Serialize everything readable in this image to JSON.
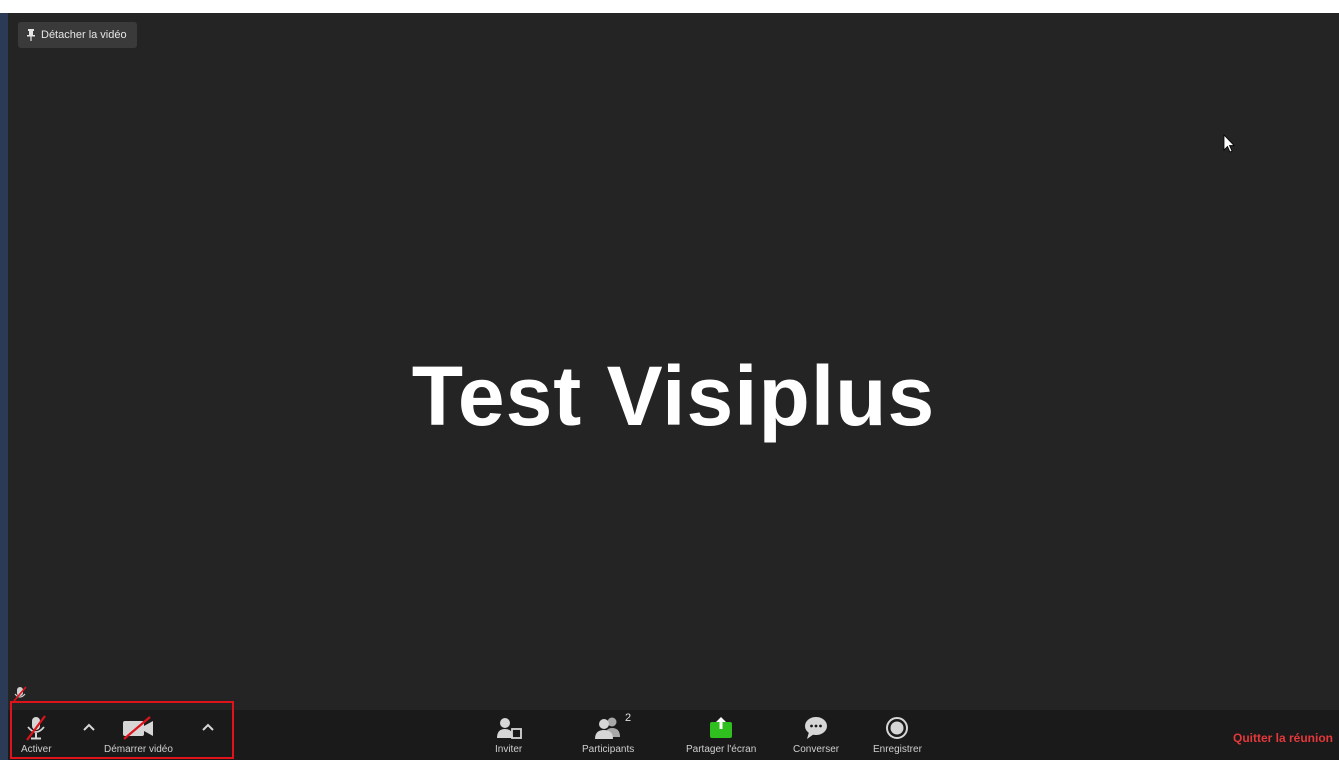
{
  "video": {
    "detach_label": "Détacher la vidéo",
    "participant_name": "Test Visiplus"
  },
  "toolbar": {
    "unmute_label": "Activer",
    "start_video_label": "Démarrer vidéo",
    "invite_label": "Inviter",
    "participants_label": "Participants",
    "participants_count": "2",
    "share_screen_label": "Partager l'écran",
    "chat_label": "Converser",
    "record_label": "Enregistrer",
    "leave_label": "Quitter la réunion"
  },
  "colors": {
    "share_green": "#2fbf1e",
    "leave_red": "#e5383b",
    "highlight_red": "#e0121b"
  }
}
